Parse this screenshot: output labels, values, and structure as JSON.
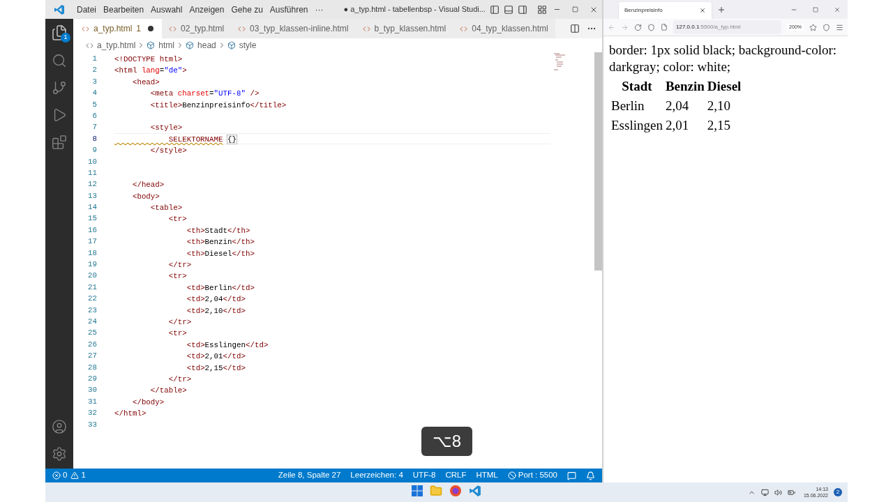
{
  "title_bar": {
    "menu": [
      "Datei",
      "Bearbeiten",
      "Auswahl",
      "Anzeigen",
      "Gehe zu",
      "Ausführen",
      "···"
    ],
    "title": "● a_typ.html - tabellenbsp - Visual Studi..."
  },
  "activity_bar": {
    "explorer_badge": "1"
  },
  "tabs": [
    {
      "label": "a_typ.html",
      "count": "1",
      "modified": true,
      "selected": true
    },
    {
      "label": "02_typ.html",
      "modified": false,
      "selected": false
    },
    {
      "label": "03_typ_klassen-inline.html",
      "modified": false,
      "selected": false
    },
    {
      "label": "b_typ_klassen.html",
      "modified": false,
      "selected": false
    },
    {
      "label": "04_typ_klassen.html",
      "modified": false,
      "selected": false
    }
  ],
  "breadcrumb": [
    {
      "label": "a_typ.html",
      "kind": "file"
    },
    {
      "label": "html",
      "kind": "element"
    },
    {
      "label": "head",
      "kind": "element"
    },
    {
      "label": "style",
      "kind": "element"
    }
  ],
  "code_lines": [
    {
      "number": "1",
      "current": false,
      "segments": [
        {
          "kind": "punct",
          "text": "<!DOCTYPE "
        },
        {
          "kind": "tag",
          "text": "html"
        },
        {
          "kind": "punct",
          "text": ">"
        }
      ]
    },
    {
      "number": "2",
      "current": false,
      "segments": [
        {
          "kind": "punct",
          "text": "<"
        },
        {
          "kind": "tag",
          "text": "html "
        },
        {
          "kind": "attr",
          "text": "lang"
        },
        {
          "kind": "text",
          "text": "="
        },
        {
          "kind": "string",
          "text": "\"de\""
        },
        {
          "kind": "punct",
          "text": ">"
        }
      ]
    },
    {
      "number": "3",
      "current": false,
      "segments": [
        {
          "kind": "punct",
          "text": "    <"
        },
        {
          "kind": "tag",
          "text": "head"
        },
        {
          "kind": "punct",
          "text": ">"
        }
      ]
    },
    {
      "number": "4",
      "current": false,
      "segments": [
        {
          "kind": "punct",
          "text": "        <"
        },
        {
          "kind": "tag",
          "text": "meta "
        },
        {
          "kind": "attr",
          "text": "charset"
        },
        {
          "kind": "text",
          "text": "="
        },
        {
          "kind": "string",
          "text": "\"UTF-8\""
        },
        {
          "kind": "punct",
          "text": " />"
        }
      ]
    },
    {
      "number": "5",
      "current": false,
      "segments": [
        {
          "kind": "punct",
          "text": "        <"
        },
        {
          "kind": "tag",
          "text": "title"
        },
        {
          "kind": "punct",
          "text": ">"
        },
        {
          "kind": "text",
          "text": "Benzinpreisinfo"
        },
        {
          "kind": "punct",
          "text": "</"
        },
        {
          "kind": "tag",
          "text": "title"
        },
        {
          "kind": "punct",
          "text": ">"
        }
      ]
    },
    {
      "number": "6",
      "current": false
    },
    {
      "number": "7",
      "current": false,
      "segments": [
        {
          "kind": "punct",
          "text": "        <"
        },
        {
          "kind": "tag",
          "text": "style"
        },
        {
          "kind": "punct",
          "text": ">"
        }
      ]
    },
    {
      "number": "8",
      "current": true,
      "segments": [
        {
          "kind": "warning",
          "text": "            SELEKTORNAME"
        },
        {
          "kind": "bracket",
          "text": "{}"
        }
      ]
    },
    {
      "number": "9",
      "current": false,
      "segments": [
        {
          "kind": "punct",
          "text": "        </"
        },
        {
          "kind": "tag",
          "text": "style"
        },
        {
          "kind": "punct",
          "text": ">"
        }
      ]
    },
    {
      "number": "10",
      "current": false
    },
    {
      "number": "11",
      "current": false
    },
    {
      "number": "12",
      "current": false,
      "segments": [
        {
          "kind": "punct",
          "text": "    </"
        },
        {
          "kind": "tag",
          "text": "head"
        },
        {
          "kind": "punct",
          "text": ">"
        }
      ]
    },
    {
      "number": "13",
      "current": false,
      "segments": [
        {
          "kind": "punct",
          "text": "    <"
        },
        {
          "kind": "tag",
          "text": "body"
        },
        {
          "kind": "punct",
          "text": ">"
        }
      ]
    },
    {
      "number": "14",
      "current": false,
      "segments": [
        {
          "kind": "punct",
          "text": "        <"
        },
        {
          "kind": "tag",
          "text": "table"
        },
        {
          "kind": "punct",
          "text": ">"
        }
      ]
    },
    {
      "number": "15",
      "current": false,
      "segments": [
        {
          "kind": "punct",
          "text": "            <"
        },
        {
          "kind": "tag",
          "text": "tr"
        },
        {
          "kind": "punct",
          "text": ">"
        }
      ]
    },
    {
      "number": "16",
      "current": false,
      "segments": [
        {
          "kind": "punct",
          "text": "                <"
        },
        {
          "kind": "tag",
          "text": "th"
        },
        {
          "kind": "punct",
          "text": ">"
        },
        {
          "kind": "text",
          "text": "Stadt"
        },
        {
          "kind": "punct",
          "text": "</"
        },
        {
          "kind": "tag",
          "text": "th"
        },
        {
          "kind": "punct",
          "text": ">"
        }
      ]
    },
    {
      "number": "17",
      "current": false,
      "segments": [
        {
          "kind": "punct",
          "text": "                <"
        },
        {
          "kind": "tag",
          "text": "th"
        },
        {
          "kind": "punct",
          "text": ">"
        },
        {
          "kind": "text",
          "text": "Benzin"
        },
        {
          "kind": "punct",
          "text": "</"
        },
        {
          "kind": "tag",
          "text": "th"
        },
        {
          "kind": "punct",
          "text": ">"
        }
      ]
    },
    {
      "number": "18",
      "current": false,
      "segments": [
        {
          "kind": "punct",
          "text": "                <"
        },
        {
          "kind": "tag",
          "text": "th"
        },
        {
          "kind": "punct",
          "text": ">"
        },
        {
          "kind": "text",
          "text": "Diesel"
        },
        {
          "kind": "punct",
          "text": "</"
        },
        {
          "kind": "tag",
          "text": "th"
        },
        {
          "kind": "punct",
          "text": ">"
        }
      ]
    },
    {
      "number": "19",
      "current": false,
      "segments": [
        {
          "kind": "punct",
          "text": "            </"
        },
        {
          "kind": "tag",
          "text": "tr"
        },
        {
          "kind": "punct",
          "text": ">"
        }
      ]
    },
    {
      "number": "20",
      "current": false,
      "segments": [
        {
          "kind": "punct",
          "text": "            <"
        },
        {
          "kind": "tag",
          "text": "tr"
        },
        {
          "kind": "punct",
          "text": ">"
        }
      ]
    },
    {
      "number": "21",
      "current": false,
      "segments": [
        {
          "kind": "punct",
          "text": "                <"
        },
        {
          "kind": "tag",
          "text": "td"
        },
        {
          "kind": "punct",
          "text": ">"
        },
        {
          "kind": "text",
          "text": "Berlin"
        },
        {
          "kind": "punct",
          "text": "</"
        },
        {
          "kind": "tag",
          "text": "td"
        },
        {
          "kind": "punct",
          "text": ">"
        }
      ]
    },
    {
      "number": "22",
      "current": false,
      "segments": [
        {
          "kind": "punct",
          "text": "                <"
        },
        {
          "kind": "tag",
          "text": "td"
        },
        {
          "kind": "punct",
          "text": ">"
        },
        {
          "kind": "text",
          "text": "2,04"
        },
        {
          "kind": "punct",
          "text": "</"
        },
        {
          "kind": "tag",
          "text": "td"
        },
        {
          "kind": "punct",
          "text": ">"
        }
      ]
    },
    {
      "number": "23",
      "current": false,
      "segments": [
        {
          "kind": "punct",
          "text": "                <"
        },
        {
          "kind": "tag",
          "text": "td"
        },
        {
          "kind": "punct",
          "text": ">"
        },
        {
          "kind": "text",
          "text": "2,10"
        },
        {
          "kind": "punct",
          "text": "</"
        },
        {
          "kind": "tag",
          "text": "td"
        },
        {
          "kind": "punct",
          "text": ">"
        }
      ]
    },
    {
      "number": "24",
      "current": false,
      "segments": [
        {
          "kind": "punct",
          "text": "            </"
        },
        {
          "kind": "tag",
          "text": "tr"
        },
        {
          "kind": "punct",
          "text": ">"
        }
      ]
    },
    {
      "number": "25",
      "current": false,
      "segments": [
        {
          "kind": "punct",
          "text": "            <"
        },
        {
          "kind": "tag",
          "text": "tr"
        },
        {
          "kind": "punct",
          "text": ">"
        }
      ]
    },
    {
      "number": "26",
      "current": false,
      "segments": [
        {
          "kind": "punct",
          "text": "                <"
        },
        {
          "kind": "tag",
          "text": "td"
        },
        {
          "kind": "punct",
          "text": ">"
        },
        {
          "kind": "text",
          "text": "Esslingen"
        },
        {
          "kind": "punct",
          "text": "</"
        },
        {
          "kind": "tag",
          "text": "td"
        },
        {
          "kind": "punct",
          "text": ">"
        }
      ]
    },
    {
      "number": "27",
      "current": false,
      "segments": [
        {
          "kind": "punct",
          "text": "                <"
        },
        {
          "kind": "tag",
          "text": "td"
        },
        {
          "kind": "punct",
          "text": ">"
        },
        {
          "kind": "text",
          "text": "2,01"
        },
        {
          "kind": "punct",
          "text": "</"
        },
        {
          "kind": "tag",
          "text": "td"
        },
        {
          "kind": "punct",
          "text": ">"
        }
      ]
    },
    {
      "number": "28",
      "current": false,
      "segments": [
        {
          "kind": "punct",
          "text": "                <"
        },
        {
          "kind": "tag",
          "text": "td"
        },
        {
          "kind": "punct",
          "text": ">"
        },
        {
          "kind": "text",
          "text": "2,15"
        },
        {
          "kind": "punct",
          "text": "</"
        },
        {
          "kind": "tag",
          "text": "td"
        },
        {
          "kind": "punct",
          "text": ">"
        }
      ]
    },
    {
      "number": "29",
      "current": false,
      "segments": [
        {
          "kind": "punct",
          "text": "            </"
        },
        {
          "kind": "tag",
          "text": "tr"
        },
        {
          "kind": "punct",
          "text": ">"
        }
      ]
    },
    {
      "number": "30",
      "current": false,
      "segments": [
        {
          "kind": "punct",
          "text": "        </"
        },
        {
          "kind": "tag",
          "text": "table"
        },
        {
          "kind": "punct",
          "text": ">"
        }
      ]
    },
    {
      "number": "31",
      "current": false,
      "segments": [
        {
          "kind": "punct",
          "text": "    </"
        },
        {
          "kind": "tag",
          "text": "body"
        },
        {
          "kind": "punct",
          "text": ">"
        }
      ]
    },
    {
      "number": "32",
      "current": false,
      "segments": [
        {
          "kind": "punct",
          "text": "</"
        },
        {
          "kind": "tag",
          "text": "html"
        },
        {
          "kind": "punct",
          "text": ">"
        }
      ]
    },
    {
      "number": "33",
      "current": false
    }
  ],
  "key_overlay": "⌥8",
  "status_bar": {
    "errors": "0",
    "warnings": "1",
    "items": [
      "Zeile 8, Spalte 27",
      "Leerzeichen: 4",
      "UTF-8",
      "CRLF",
      "HTML"
    ],
    "port": "Port : 5500"
  },
  "browser": {
    "tab_title": "Benzinpreisinfo",
    "url_host": "127.0.0.1",
    "url_rest": ":5500/a_typ.html",
    "zoom": "200%",
    "paragraph": "border: 1px solid black; background-color: darkgray; color: white;",
    "table": {
      "columns": [
        "Stadt",
        "Benzin",
        "Diesel"
      ],
      "rows": [
        [
          "Berlin",
          "2,04",
          "2,10"
        ],
        [
          "Esslingen",
          "2,01",
          "2,15"
        ]
      ]
    }
  },
  "taskbar": {
    "time": "14:13",
    "date": "15.06.2022",
    "notifications": "2"
  }
}
